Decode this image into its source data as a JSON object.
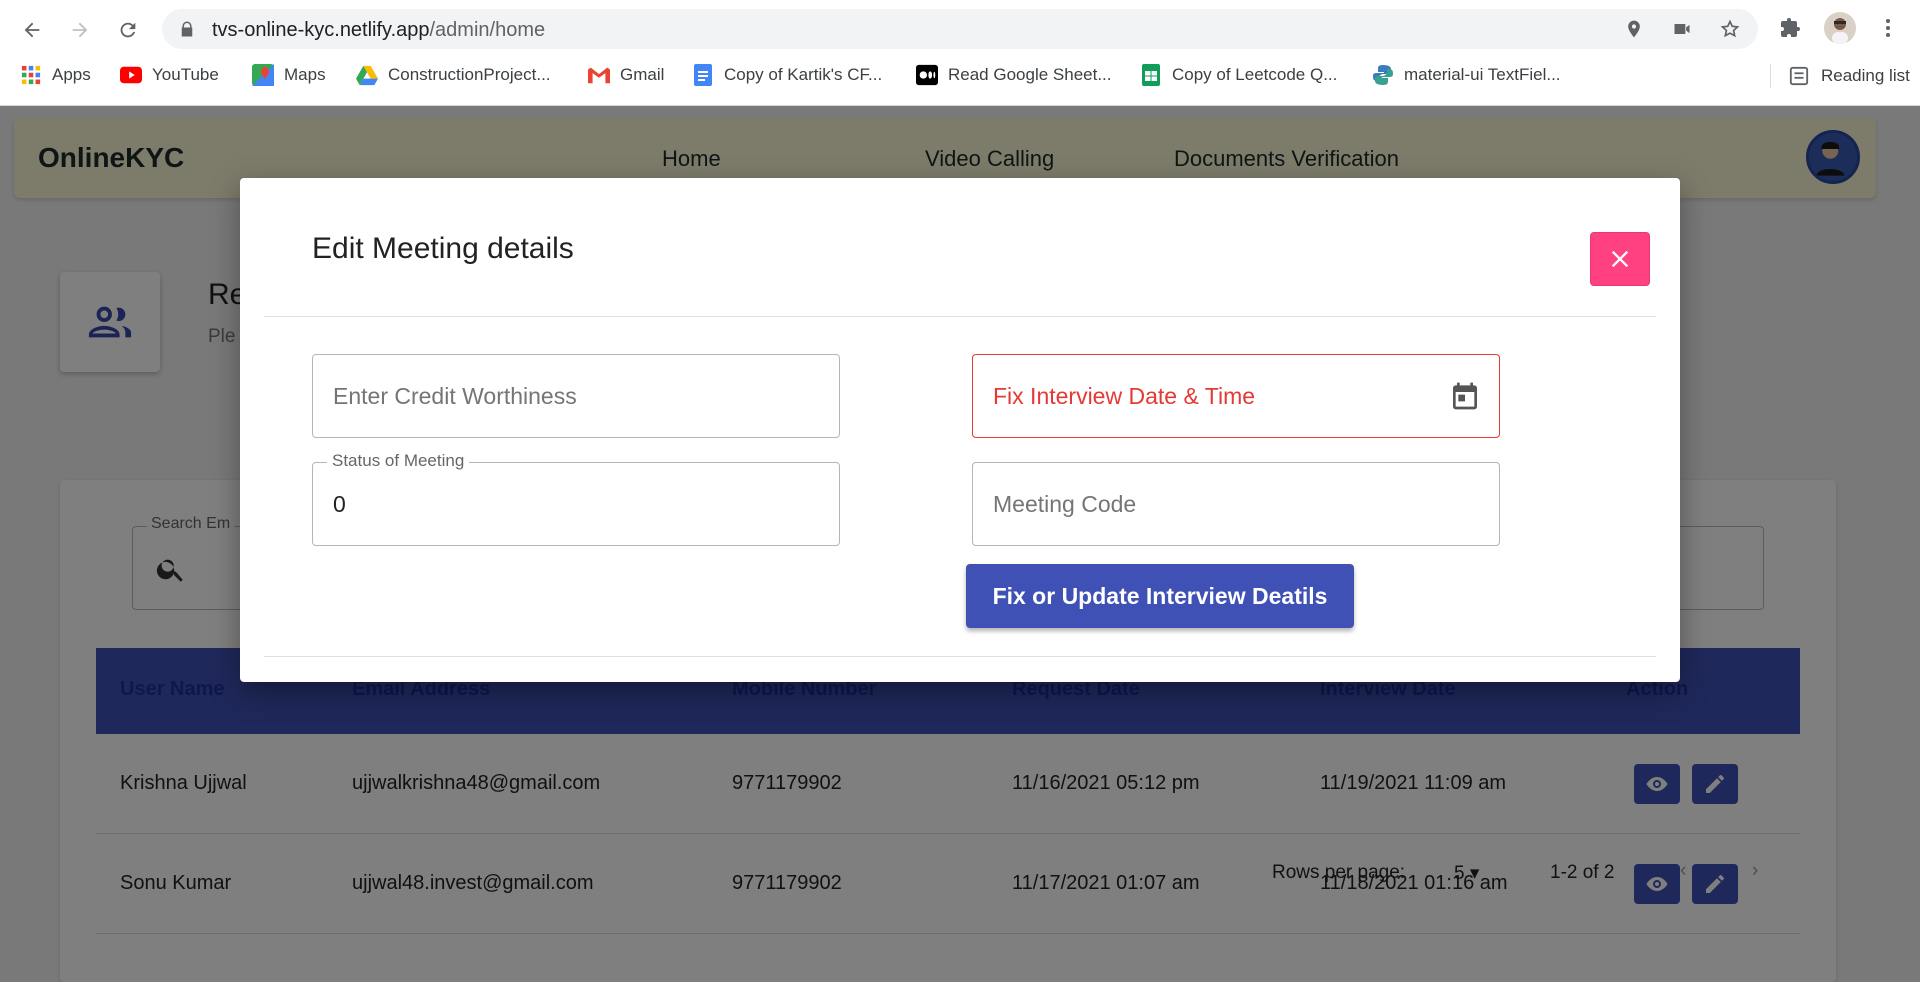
{
  "browser": {
    "url_host": "tvs-online-kyc.netlify.app",
    "url_path": "/admin/home",
    "bookmarks": [
      {
        "label": "Apps",
        "icon": "apps-grid-icon"
      },
      {
        "label": "YouTube",
        "icon": "youtube-icon"
      },
      {
        "label": "Maps",
        "icon": "maps-icon"
      },
      {
        "label": "ConstructionProject...",
        "icon": "google-drive-icon"
      },
      {
        "label": "Gmail",
        "icon": "gmail-icon"
      },
      {
        "label": "Copy of Kartik's CF...",
        "icon": "google-docs-icon"
      },
      {
        "label": "Read Google Sheet...",
        "icon": "medium-icon"
      },
      {
        "label": "Copy of Leetcode Q...",
        "icon": "google-sheets-icon"
      },
      {
        "label": "material-ui TextFiel...",
        "icon": "python-icon"
      }
    ],
    "reading_list": "Reading list"
  },
  "app": {
    "brand": "OnlineKYC",
    "nav": [
      "Home",
      "Video Calling",
      "Documents Verification"
    ],
    "requests_title": "Re",
    "requests_sub": "Ple",
    "search_label": "Search Em",
    "table": {
      "headers": [
        "User Name",
        "Email Address",
        "Mobile Number",
        "Request Date",
        "Interview Date",
        "Action"
      ],
      "rows": [
        [
          "Krishna Ujjwal",
          "ujjwalkrishna48@gmail.com",
          "9771179902",
          "11/16/2021 05:12 pm",
          "11/19/2021 11:09 am"
        ],
        [
          "Sonu Kumar",
          "ujjwal48.invest@gmail.com",
          "9771179902",
          "11/17/2021 01:07 am",
          "11/18/2021 01:16 am"
        ]
      ]
    },
    "pagination": {
      "rows_per_page_label": "Rows per page:",
      "rows_per_page_value": "5",
      "range": "1-2 of 2"
    },
    "colors": {
      "primary": "#3f51b5",
      "close": "#ff4081",
      "error": "#e53935"
    }
  },
  "modal": {
    "title": "Edit Meeting details",
    "credit_placeholder": "Enter Credit Worthiness",
    "interview_placeholder": "Fix Interview Date & Time",
    "status_label": "Status of Meeting",
    "status_value": "0",
    "meeting_code_placeholder": "Meeting Code",
    "submit_label": "Fix or Update Interview Deatils"
  }
}
